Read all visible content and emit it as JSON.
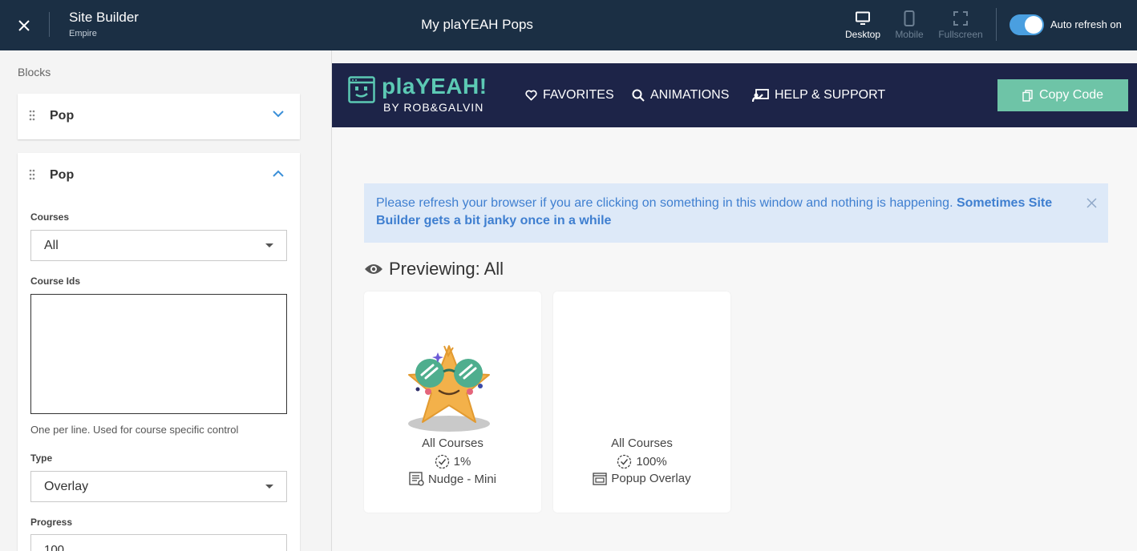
{
  "topbar": {
    "title": "Site Builder",
    "subtitle": "Empire",
    "page_name": "My plaYEAH Pops",
    "views": [
      {
        "label": "Desktop",
        "icon": "desktop-icon",
        "active": true
      },
      {
        "label": "Mobile",
        "icon": "mobile-icon",
        "active": false
      },
      {
        "label": "Fullscreen",
        "icon": "fullscreen-icon",
        "active": false
      }
    ],
    "auto_refresh_label": "Auto refresh on",
    "auto_refresh_on": true
  },
  "left_panel": {
    "section_label": "Blocks",
    "blocks": [
      {
        "title": "Pop",
        "expanded": false
      },
      {
        "title": "Pop",
        "expanded": true,
        "fields": {
          "courses_label": "Courses",
          "courses_value": "All",
          "course_ids_label": "Course Ids",
          "course_ids_value": "",
          "course_ids_help": "One per line. Used for course specific control",
          "type_label": "Type",
          "type_value": "Overlay",
          "progress_label": "Progress",
          "progress_value": "100"
        }
      }
    ]
  },
  "preview": {
    "nav": {
      "logo_text": "plaYEAH!",
      "logo_sub": "BY ROB&GALVIN",
      "links": [
        {
          "label": "FAVORITES",
          "icon": "heart-icon"
        },
        {
          "label": "ANIMATIONS",
          "icon": "search-icon"
        },
        {
          "label": "HELP & SUPPORT",
          "icon": "support-icon"
        }
      ],
      "copy_button": "Copy Code"
    },
    "alert": {
      "text": "Please refresh your browser if you are clicking on something in this window and nothing is happening. ",
      "bold": "Sometimes Site Builder gets a bit janky once in a while"
    },
    "previewing": "Previewing: All",
    "cards": [
      {
        "courses": "All Courses",
        "progress": "1%",
        "type": "Nudge - Mini",
        "has_image": true,
        "image": "star-with-glasses"
      },
      {
        "courses": "All Courses",
        "progress": "100%",
        "type": "Popup Overlay",
        "has_image": false
      }
    ]
  },
  "colors": {
    "topbar_bg": "#1b2f44",
    "site_nav_bg": "#1d2448",
    "brand_teal": "#5cc9b4",
    "copy_button_bg": "#6ec4a7",
    "toggle_on": "#4a9fe0",
    "alert_bg": "#dde9f8",
    "alert_text": "#3f7fd0",
    "accent_blue": "#3a8fd8"
  }
}
